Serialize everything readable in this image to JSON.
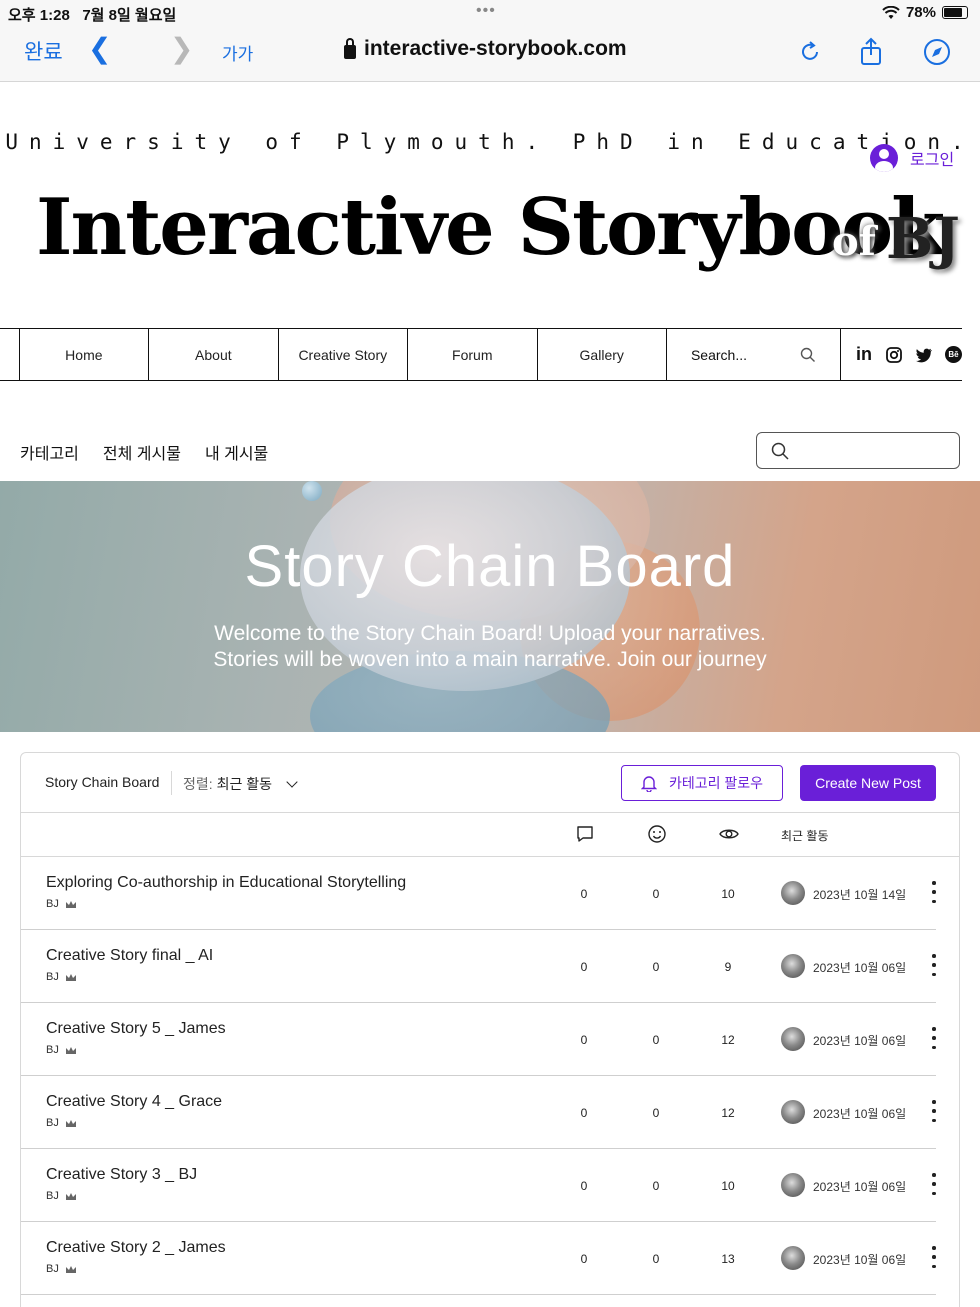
{
  "status_bar": {
    "time": "오후 1:28",
    "date": "7월 8일 월요일",
    "battery": "78%"
  },
  "browser": {
    "done_label": "완료",
    "text_size_label": "가가",
    "url": "interactive-storybook.com"
  },
  "site": {
    "tagline": "University of Plymouth. PhD in Education.",
    "login_label": "로그인",
    "title": "Interactive Storybook",
    "title_of": "of",
    "title_bj": "BJ"
  },
  "nav": {
    "items": [
      "Home",
      "About",
      "Creative Story",
      "Forum",
      "Gallery"
    ],
    "search_label": "Search...",
    "social": [
      "linkedin-icon",
      "instagram-icon",
      "twitter-icon",
      "behance-icon"
    ]
  },
  "subnav": {
    "items": [
      "카테고리",
      "전체 게시물",
      "내 게시물"
    ]
  },
  "hero": {
    "title": "Story Chain Board",
    "subtitle_line1": "Welcome to the Story Chain Board! Upload your narratives.",
    "subtitle_line2": "Stories will be woven into a main narrative. Join our journey"
  },
  "board": {
    "title": "Story Chain Board",
    "sort_label": "정렬:",
    "sort_value": "최근 활동",
    "follow_label": "카테고리 팔로우",
    "create_label": "Create New Post",
    "recent_activity_label": "최근 활동",
    "colors": {
      "accent": "#6a1fd8"
    },
    "posts": [
      {
        "title": "Exploring Co-authorship in Educational Storytelling",
        "author": "BJ",
        "comments": "0",
        "likes": "0",
        "views": "10",
        "date": "2023년 10월 14일"
      },
      {
        "title": "Creative Story final _ AI",
        "author": "BJ",
        "comments": "0",
        "likes": "0",
        "views": "9",
        "date": "2023년 10월 06일"
      },
      {
        "title": "Creative Story 5 _ James",
        "author": "BJ",
        "comments": "0",
        "likes": "0",
        "views": "12",
        "date": "2023년 10월 06일"
      },
      {
        "title": "Creative Story 4 _ Grace",
        "author": "BJ",
        "comments": "0",
        "likes": "0",
        "views": "12",
        "date": "2023년 10월 06일"
      },
      {
        "title": "Creative Story 3 _ BJ",
        "author": "BJ",
        "comments": "0",
        "likes": "0",
        "views": "10",
        "date": "2023년 10월 06일"
      },
      {
        "title": "Creative Story 2 _ James",
        "author": "BJ",
        "comments": "0",
        "likes": "0",
        "views": "13",
        "date": "2023년 10월 06일"
      }
    ]
  }
}
